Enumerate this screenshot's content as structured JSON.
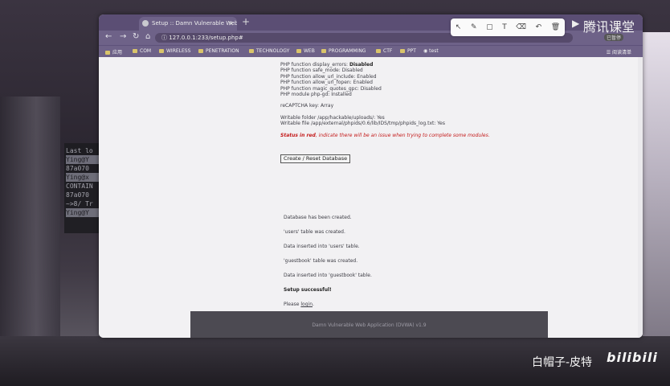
{
  "browser": {
    "tab_title": "Setup :: Damn Vulnerable Web",
    "url": "127.0.0.1:233/setup.php#",
    "bookmarks": [
      "应用",
      "COM",
      "WIRELESS",
      "PENETRATION",
      "TECHNOLOGY",
      "WEB",
      "PROGRAMMING",
      "CTF",
      "PPT",
      "test"
    ],
    "bookmark_right": "阅读清单",
    "user_badge": "已暂停"
  },
  "page": {
    "php_lines": [
      {
        "label": "PHP function display_errors:",
        "value": "Disabled",
        "bold": true
      },
      {
        "label": "PHP function safe_mode:",
        "value": "Disabled"
      },
      {
        "label": "PHP function allow_url_include:",
        "value": "Enabled"
      },
      {
        "label": "PHP function allow_url_fopen:",
        "value": "Enabled"
      },
      {
        "label": "PHP function magic_quotes_gpc:",
        "value": "Disabled"
      },
      {
        "label": "PHP module php-gd:",
        "value": "Installed"
      }
    ],
    "recaptcha": "reCAPTCHA key: Array",
    "writable_folder": "Writable folder /app/hackable/uploads/: Yes",
    "writable_file": "Writable file /app/external/phpids/0.6/lib/IDS/tmp/phpids_log.txt: Yes",
    "status_bold": "Status in red",
    "status_rest": ", indicate there will be an issue when trying to complete some modules.",
    "button_label": "Create / Reset Database",
    "messages": [
      "Database has been created.",
      "'users' table was created.",
      "Data inserted into 'users' table.",
      "'guestbook' table was created.",
      "Data inserted into 'guestbook' table."
    ],
    "setup_success": "Setup successful!",
    "please_prefix": "Please ",
    "login_link": "login",
    "please_suffix": ".",
    "footer": "Damn Vulnerable Web Application (DVWA) v1.9"
  },
  "terminal_lines": [
    "Last lo",
    "Ying@Y",
    "87a070",
    "Ying@x",
    "CONTAIN",
    "87a070",
    "~>8/ Tr",
    "Ying@Y"
  ],
  "overlay": {
    "brand": "腾讯课堂",
    "signature": "白帽子-皮特",
    "bilibili": "bilibili"
  }
}
